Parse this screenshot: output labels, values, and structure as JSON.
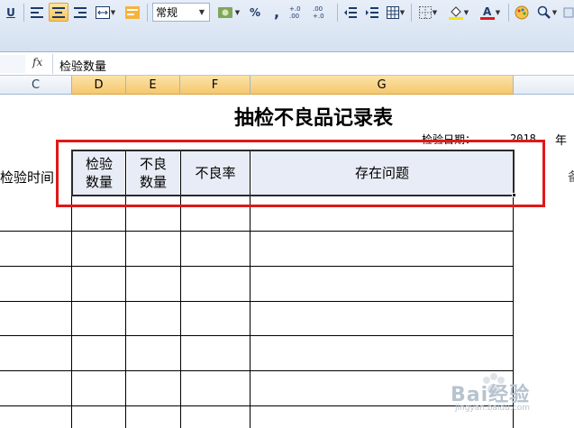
{
  "toolbar": {
    "underline": "U",
    "number_format": "常规",
    "percent": "%",
    "comma": ",",
    "increase_decimal": "+.0 .00",
    "decrease_decimal": ".00 +.0"
  },
  "formula_bar": {
    "fx": "fx",
    "value": "检验数量"
  },
  "columns": [
    "C",
    "D",
    "E",
    "F",
    "G"
  ],
  "sheet": {
    "title": "抽检不良品记录表",
    "date_label": "检验日期：",
    "date_year": "2018",
    "date_year_suffix": "年",
    "headers": {
      "inspection_time": "检验时间",
      "inspection_qty": "检验\n数量",
      "defect_qty": "不良\n数量",
      "defect_rate": "不良率",
      "issues": "存在问题"
    },
    "tail_char": "备"
  },
  "watermark": {
    "brand": "Bai经验",
    "url": "jingyan.baidu.com"
  },
  "colors": {
    "highlight_box": "#e01818",
    "header_fill": "#e8ecf6",
    "selected_col": "#f5c76f"
  }
}
